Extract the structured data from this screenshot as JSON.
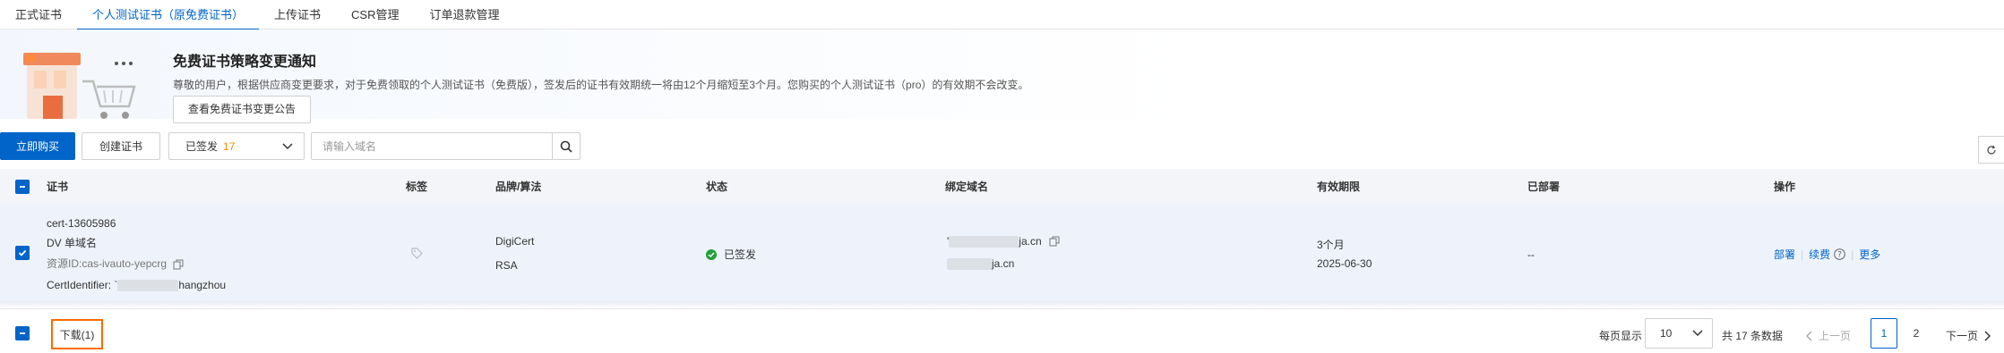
{
  "tabs": [
    {
      "label": "正式证书",
      "active": false
    },
    {
      "label": "个人测试证书（原免费证书）",
      "active": true
    },
    {
      "label": "上传证书",
      "active": false
    },
    {
      "label": "CSR管理",
      "active": false
    },
    {
      "label": "订单退款管理",
      "active": false
    }
  ],
  "notice": {
    "title": "免费证书策略变更通知",
    "text": "尊敬的用户，根据供应商变更要求，对于免费领取的个人测试证书（免费版），签发后的证书有效期统一将由12个月缩短至3个月。您购买的个人测试证书（pro）的有效期不会改变。",
    "button": "查看免费证书变更公告"
  },
  "toolbar": {
    "buy_label": "立即购买",
    "create_label": "创建证书",
    "status_select": {
      "label": "已签发",
      "count": "17"
    },
    "search_placeholder": "请输入域名"
  },
  "table": {
    "headers": {
      "cert": "证书",
      "tag": "标签",
      "brand": "品牌/算法",
      "status": "状态",
      "domain": "绑定域名",
      "validity": "有效期限",
      "deployed": "已部署",
      "actions": "操作"
    },
    "rows": [
      {
        "name": "cert-13605986",
        "type": "DV 单域名",
        "resource_id": "资源ID:cas-ivauto-yepcrg",
        "cert_identifier_prefix": "CertIdentifier: `",
        "cert_identifier_suffix": "hangzhou",
        "brand": "DigiCert",
        "algorithm": "RSA",
        "status": "已签发",
        "domain1_prefix": "'",
        "domain1_suffix": "ja.cn",
        "domain2_suffix": "ja.cn",
        "validity_period": "3个月",
        "validity_date": "2025-06-30",
        "deployed": "--",
        "action_deploy": "部署",
        "action_renew": "续费",
        "action_more": "更多"
      }
    ]
  },
  "footer": {
    "download_label": "下载(1)",
    "page_size_label": "每页显示",
    "page_size": "10",
    "total": "共 17 条数据",
    "prev": "上一页",
    "next": "下一页",
    "pages": [
      "1",
      "2"
    ]
  },
  "colors": {
    "primary": "#0064c8",
    "accent": "#ff6a00",
    "success": "#22a03a"
  }
}
